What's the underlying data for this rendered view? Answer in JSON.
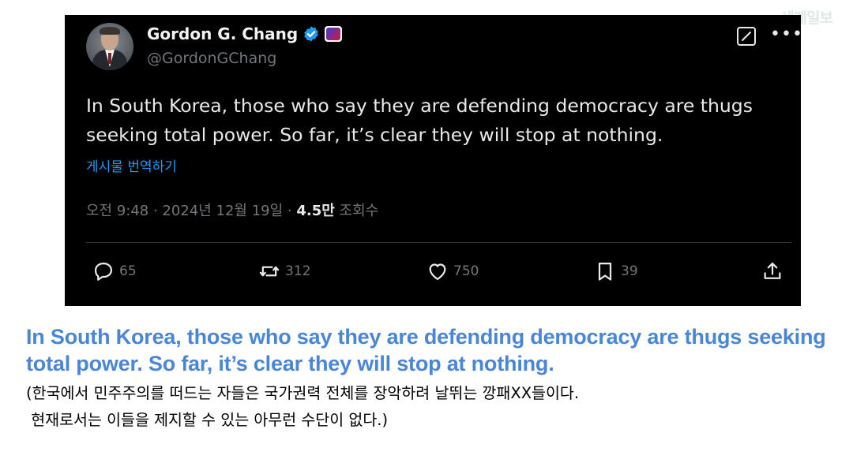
{
  "watermark": "세계일보",
  "tweet": {
    "author_name": "Gordon G. Chang",
    "handle": "@GordonGChang",
    "text": "In South Korea, those who say they are defending democracy are thugs seeking total power. So far, it’s clear they will stop at nothing.",
    "translate_label": "게시물 번역하기",
    "timestamp": "오전 9:48 · 2024년 12월 19일",
    "separator": " · ",
    "views_count": "4.5만",
    "views_label": " 조회수",
    "replies": "65",
    "reposts": "312",
    "likes": "750",
    "bookmarks": "39",
    "icons": [
      "verified-badge-icon",
      "affiliation-badge-icon",
      "grok-icon",
      "more-icon",
      "reply-icon",
      "repost-icon",
      "like-icon",
      "bookmark-icon",
      "share-icon"
    ]
  },
  "caption": {
    "english": "In South Korea, those who say they are defending democracy are thugs seeking total power. So far, it’s clear they will stop at nothing.",
    "korean_line1": "(한국에서 민주주의를 떠드는 자들은 국가권력 전체를 장악하려 날뛰는 깡패XX들이다.",
    "korean_line2": " 현재로서는 이들을 제지할 수 있는 아무런 수단이 없다.)"
  },
  "colors": {
    "tweet_bg": "#000000",
    "link_blue": "#1d9bf0",
    "caption_blue": "#4a86d8",
    "muted_gray": "#71767b"
  }
}
